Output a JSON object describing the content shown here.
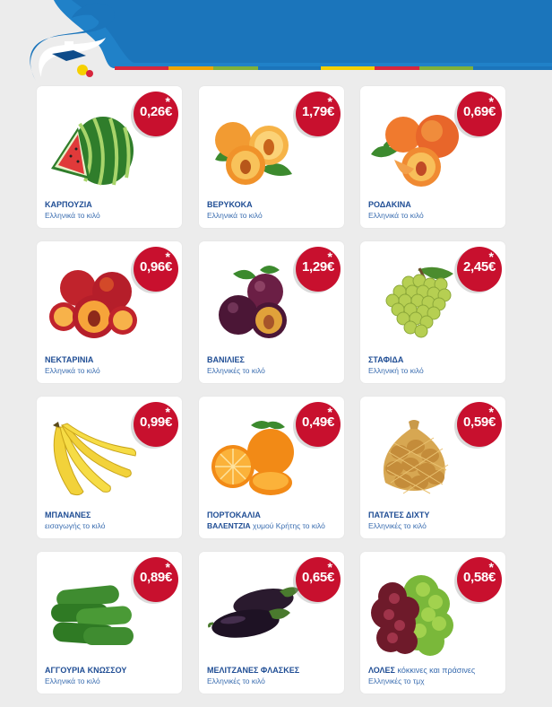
{
  "brand": {
    "colors": {
      "blue": "#1b75bb",
      "red": "#c8102e",
      "text": "#1f4d94"
    }
  },
  "products": [
    {
      "name": "ΚΑΡΠΟΥΖΙΑ",
      "name_extra": "",
      "desc": "Ελληνικά το κιλό",
      "price": "0,26€",
      "icon": "watermelon-icon"
    },
    {
      "name": "ΒΕΡΥΚΟΚΑ",
      "name_extra": "",
      "desc": "Ελληνικά το κιλό",
      "price": "1,79€",
      "icon": "apricot-icon"
    },
    {
      "name": "ΡΟΔΑΚΙΝΑ",
      "name_extra": "",
      "desc": "Ελληνικά το κιλό",
      "price": "0,69€",
      "icon": "peach-icon"
    },
    {
      "name": "ΝΕΚΤΑΡΙΝΙΑ",
      "name_extra": "",
      "desc": "Ελληνικά το κιλό",
      "price": "0,96€",
      "icon": "nectarine-icon"
    },
    {
      "name": "ΒΑΝΙΛΙΕΣ",
      "name_extra": "",
      "desc": "Ελληνικές το κιλό",
      "price": "1,29€",
      "icon": "plum-icon"
    },
    {
      "name": "ΣΤΑΦΙΔΑ",
      "name_extra": "",
      "desc": "Ελληνική  το κιλό",
      "price": "2,45€",
      "icon": "grapes-icon"
    },
    {
      "name": "ΜΠΑΝΑΝΕΣ",
      "name_extra": "",
      "desc": "εισαγωγής το κιλό",
      "price": "0,99€",
      "icon": "banana-icon"
    },
    {
      "name": "ΠΟΡΤΟΚΑΛΙΑ",
      "name_extra": "",
      "desc_bold": "ΒΑΛΕΝΤΖΙΑ",
      "desc": " χυμού Κρήτης το κιλό",
      "price": "0,49€",
      "icon": "orange-icon"
    },
    {
      "name": "ΠΑΤΑΤΕΣ ΔΙΧΤΥ",
      "name_extra": "",
      "desc": "Ελληνικές το κιλό",
      "price": "0,59€",
      "icon": "potato-icon"
    },
    {
      "name": "ΑΓΓΟΥΡΙΑ  ΚΝΩΣΣΟΥ",
      "name_extra": "",
      "desc": "Ελληνικά το κιλό",
      "price": "0,89€",
      "icon": "cucumber-icon"
    },
    {
      "name": "ΜΕΛΙΤΖΑΝΕΣ ΦΛΑΣΚΕΣ",
      "name_extra": "",
      "desc": "Ελληνικές το κιλό",
      "price": "0,65€",
      "icon": "eggplant-icon"
    },
    {
      "name": "ΛΟΛΕΣ",
      "name_extra": " κόκκινες και πράσινες",
      "desc": "Ελληνικές το τμχ",
      "price": "0,58€",
      "icon": "lettuce-icon"
    }
  ]
}
